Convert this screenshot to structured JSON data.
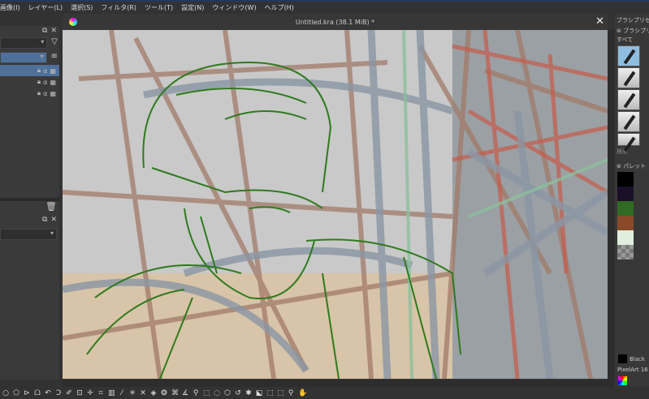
{
  "menu": [
    "画像(I)",
    "レイヤー(L)",
    "選択(S)",
    "フィルタ(R)",
    "ツール(T)",
    "設定(N)",
    "ウィンドウ(W)",
    "ヘルプ(H)"
  ],
  "document": {
    "title": "Untitled.kra (38.1 MiB) *"
  },
  "right_panel": {
    "brush_presets_title": "ブラシプリセット",
    "brush_presets_docker": "ブラシプリセット",
    "tag": "すべて",
    "search_placeholder": "検索",
    "palette_title": "パレット",
    "current_color": "Black",
    "palette_name": "PixelArt 16"
  },
  "palette_colors": [
    "#000000",
    "#1a1028",
    "#2f6b22",
    "#8a4a2a",
    "#dfeedd",
    "#999999"
  ],
  "toolbar_icons": [
    "ellipse",
    "polygon",
    "polyline",
    "bezier",
    "freehand-path",
    "dynamic-brush",
    "multibrush",
    "transform",
    "move",
    "crop",
    "gradient",
    "color-picker",
    "assistant",
    "measure",
    "fill",
    "smart-patch",
    "reference",
    "angle",
    "pin",
    "rect-select",
    "ellipse-select",
    "polygon-select",
    "freehand-select",
    "contiguous-select",
    "similar-select",
    "bezier-select",
    "magnetic-select",
    "zoom",
    "pan"
  ]
}
